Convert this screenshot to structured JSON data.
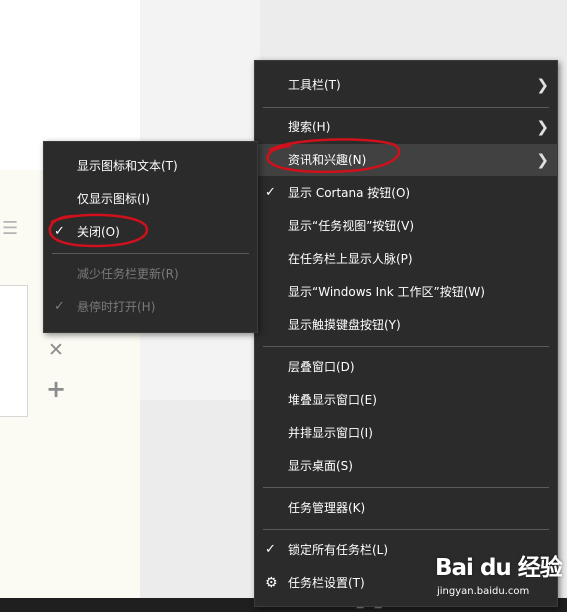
{
  "submenu": {
    "items": [
      {
        "label": "显示图标和文本(T)",
        "checked": false,
        "disabled": false
      },
      {
        "label": "仅显示图标(I)",
        "checked": false,
        "disabled": false
      },
      {
        "label": "关闭(O)",
        "checked": true,
        "disabled": false
      },
      {
        "label": "减少任务栏更新(R)",
        "checked": false,
        "disabled": true
      },
      {
        "label": "悬停时打开(H)",
        "checked": true,
        "disabled": true
      }
    ]
  },
  "main_menu": {
    "items": [
      {
        "label": "工具栏(T)",
        "has_submenu": true
      },
      {
        "label": "搜索(H)",
        "has_submenu": true
      },
      {
        "label": "资讯和兴趣(N)",
        "has_submenu": true,
        "highlighted": true
      },
      {
        "label": "显示 Cortana 按钮(O)",
        "checked": true
      },
      {
        "label": "显示“任务视图”按钮(V)"
      },
      {
        "label": "在任务栏上显示人脉(P)"
      },
      {
        "label": "显示“Windows Ink 工作区”按钮(W)"
      },
      {
        "label": "显示触摸键盘按钮(Y)"
      },
      {
        "label": "层叠窗口(D)"
      },
      {
        "label": "堆叠显示窗口(E)"
      },
      {
        "label": "并排显示窗口(I)"
      },
      {
        "label": "显示桌面(S)"
      },
      {
        "label": "任务管理器(K)"
      },
      {
        "label": "锁定所有任务栏(L)",
        "checked": true
      },
      {
        "label": "任务栏设置(T)",
        "icon": "gear-icon"
      }
    ]
  },
  "watermark": {
    "logo": "Bai du 经验",
    "url": "jingyan.baidu.com"
  },
  "icons": {
    "list": "list-icon",
    "close": "close-icon",
    "add": "plus-icon",
    "check": "check-icon",
    "arrow": "chevron-right-icon",
    "settings": "gear-icon"
  },
  "colors": {
    "menu_bg": "#2b2b2b",
    "menu_text": "#ffffff",
    "disabled_text": "#7a7a7a",
    "highlight_bg": "#414141",
    "annotation": "#d0111b"
  }
}
